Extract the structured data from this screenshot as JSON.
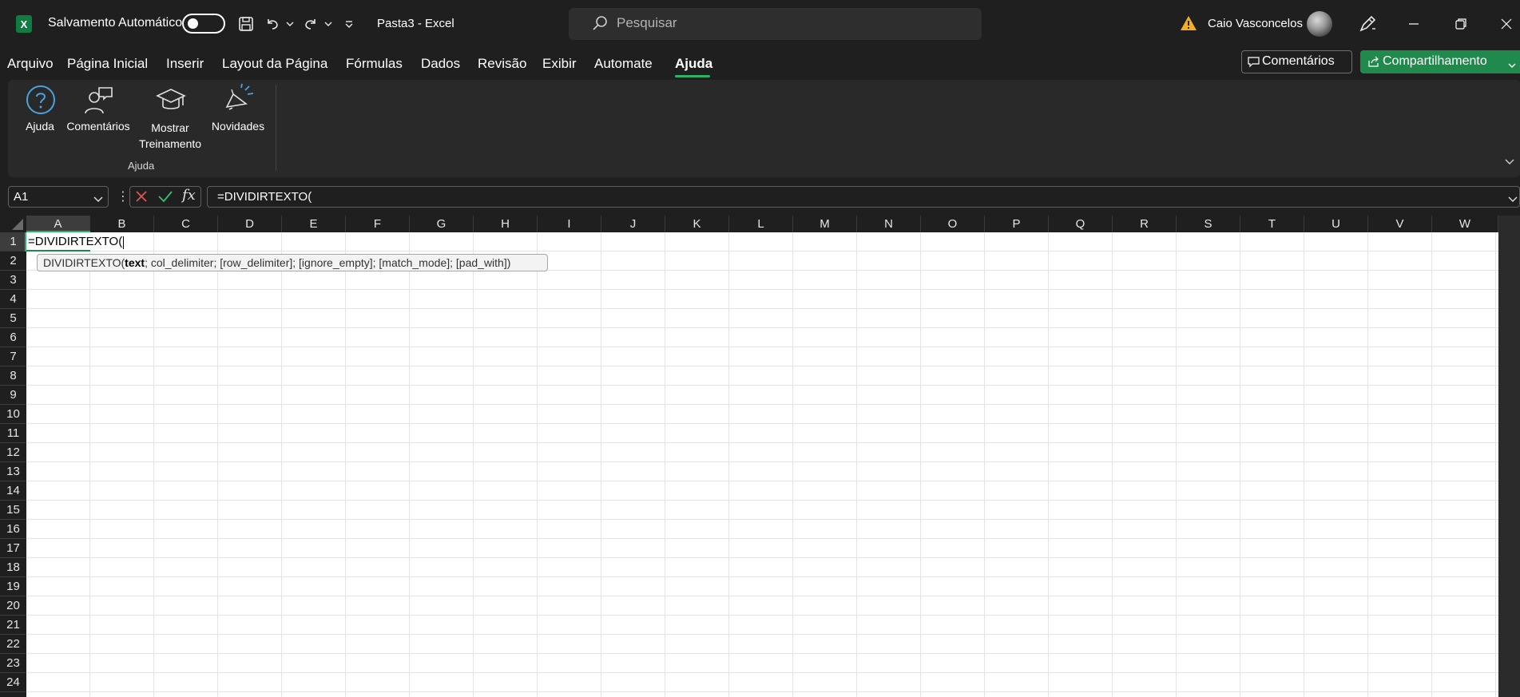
{
  "titlebar": {
    "autosave_label": "Salvamento Automático",
    "autosave_on": false,
    "document_title": "Pasta3  -  Excel",
    "search_placeholder": "Pesquisar",
    "user_name": "Caio Vasconcelos"
  },
  "menu": {
    "tabs": [
      "Arquivo",
      "Página Inicial",
      "Inserir",
      "Layout da Página",
      "Fórmulas",
      "Dados",
      "Revisão",
      "Exibir",
      "Automate",
      "Ajuda"
    ],
    "active_tab": "Ajuda",
    "comments_label": "Comentários",
    "share_label": "Compartilhamento"
  },
  "ribbon": {
    "buttons": [
      {
        "label": "Ajuda",
        "icon": "help-icon"
      },
      {
        "label": "Comentários",
        "icon": "feedback-icon"
      },
      {
        "label": "Mostrar Treinamento",
        "icon": "training-icon"
      },
      {
        "label": "Novidades",
        "icon": "whats-new-icon"
      }
    ],
    "group_label": "Ajuda"
  },
  "formula_bar": {
    "name_box": "A1",
    "formula": "=DIVIDIRTEXTO("
  },
  "grid": {
    "columns": [
      "A",
      "B",
      "C",
      "D",
      "E",
      "F",
      "G",
      "H",
      "I",
      "J",
      "K",
      "L",
      "M",
      "N",
      "O",
      "P",
      "Q",
      "R",
      "S",
      "T",
      "U",
      "V",
      "W"
    ],
    "rows": [
      "1",
      "2",
      "3",
      "4",
      "5",
      "6",
      "7",
      "8",
      "9",
      "10",
      "11",
      "12",
      "13",
      "14",
      "15",
      "16",
      "17",
      "18",
      "19",
      "20",
      "21",
      "22",
      "23",
      "24"
    ],
    "selected_cell": "A1",
    "cell_A1": "=DIVIDIRTEXTO("
  },
  "tooltip": {
    "function": "DIVIDIRTEXTO(",
    "current_arg": "text",
    "rest": "; col_delimiter; [row_delimiter]; [ignore_empty]; [match_mode]; [pad_with])"
  },
  "colors": {
    "accent": "#1f8a4c",
    "tab_underline": "#2ab367",
    "background": "#1f1f1f",
    "ribbon": "#292929"
  }
}
